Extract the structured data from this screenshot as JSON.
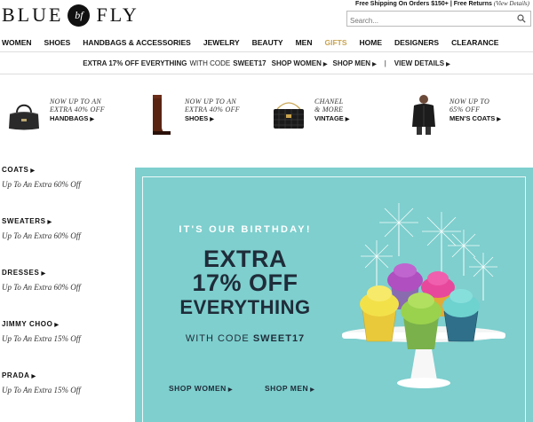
{
  "header": {
    "logo_left": "BLUE",
    "logo_mark": "bf",
    "logo_right": "FLY",
    "promo_shipping": "Free Shipping On Orders $150+ | Free Returns",
    "promo_view_details": "(View Details)",
    "search_placeholder": "Search..."
  },
  "nav": {
    "items": [
      "WOMEN",
      "SHOES",
      "HANDBAGS & ACCESSORIES",
      "JEWELRY",
      "BEAUTY",
      "MEN",
      "GIFTS",
      "HOME",
      "DESIGNERS",
      "CLEARANCE"
    ]
  },
  "promo_bar": {
    "headline": "EXTRA 17% OFF EVERYTHING",
    "with_code": "WITH CODE",
    "code": "SWEET17",
    "shop_women": "SHOP WOMEN",
    "shop_men": "SHOP MEN",
    "separator": "|",
    "view_details": "VIEW DETAILS"
  },
  "categories": [
    {
      "line1": "NOW UP TO AN",
      "line2": "EXTRA 40% OFF",
      "link": "HANDBAGS",
      "icon": "handbag-icon"
    },
    {
      "line1": "NOW UP TO AN",
      "line2": "EXTRA 40% OFF",
      "link": "SHOES",
      "icon": "boot-icon"
    },
    {
      "line1": "CHANEL",
      "line2": "& MORE",
      "link": "VINTAGE",
      "icon": "chanel-bag-icon"
    },
    {
      "line1": "NOW UP TO",
      "line2": "65% OFF",
      "link": "MEN'S COATS",
      "icon": "mens-coat-icon"
    }
  ],
  "sidebar": [
    {
      "title": "COATS",
      "sub": "Up To An Extra 60% Off"
    },
    {
      "title": "SWEATERS",
      "sub": "Up To An Extra 60% Off"
    },
    {
      "title": "DRESSES",
      "sub": "Up To An Extra 60% Off"
    },
    {
      "title": "JIMMY CHOO",
      "sub": "Up To An Extra 15% Off"
    },
    {
      "title": "PRADA",
      "sub": "Up To An Extra 15% Off"
    }
  ],
  "hero": {
    "kicker": "IT'S OUR BIRTHDAY!",
    "line1": "EXTRA",
    "line2": "17% OFF",
    "line3": "EVERYTHING",
    "with_code": "WITH CODE",
    "code": "SWEET17",
    "btn_women": "SHOP WOMEN",
    "btn_men": "SHOP MEN"
  },
  "colors": {
    "hero_bg": "#7ecfce",
    "hero_text": "#1f2c39",
    "gifts_accent": "#c9a34e"
  }
}
